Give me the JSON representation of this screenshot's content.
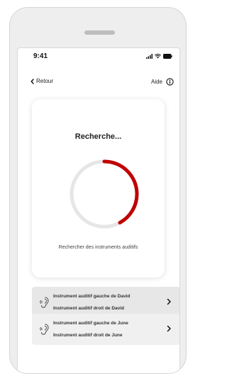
{
  "status_bar": {
    "time": "9:41"
  },
  "nav": {
    "back_label": "Retour",
    "help_label": "Aide"
  },
  "search_card": {
    "title": "Recherche...",
    "caption": "Rechercher des instruments auditifs",
    "progress": 0.42,
    "colors": {
      "track": "#e6e6e6",
      "progress": "#c00000"
    }
  },
  "devices": [
    {
      "line1": "Instrument auditif gauche de David",
      "line2": "Instrument auditif droit de David"
    },
    {
      "line1": "Instrument auditif gauche de June",
      "line2": "Instrument auditif droit de June"
    }
  ],
  "icons": {
    "back": "chevron-left-icon",
    "help": "info-icon",
    "device": "hearing-aid-icon",
    "row_action": "chevron-right-icon"
  }
}
